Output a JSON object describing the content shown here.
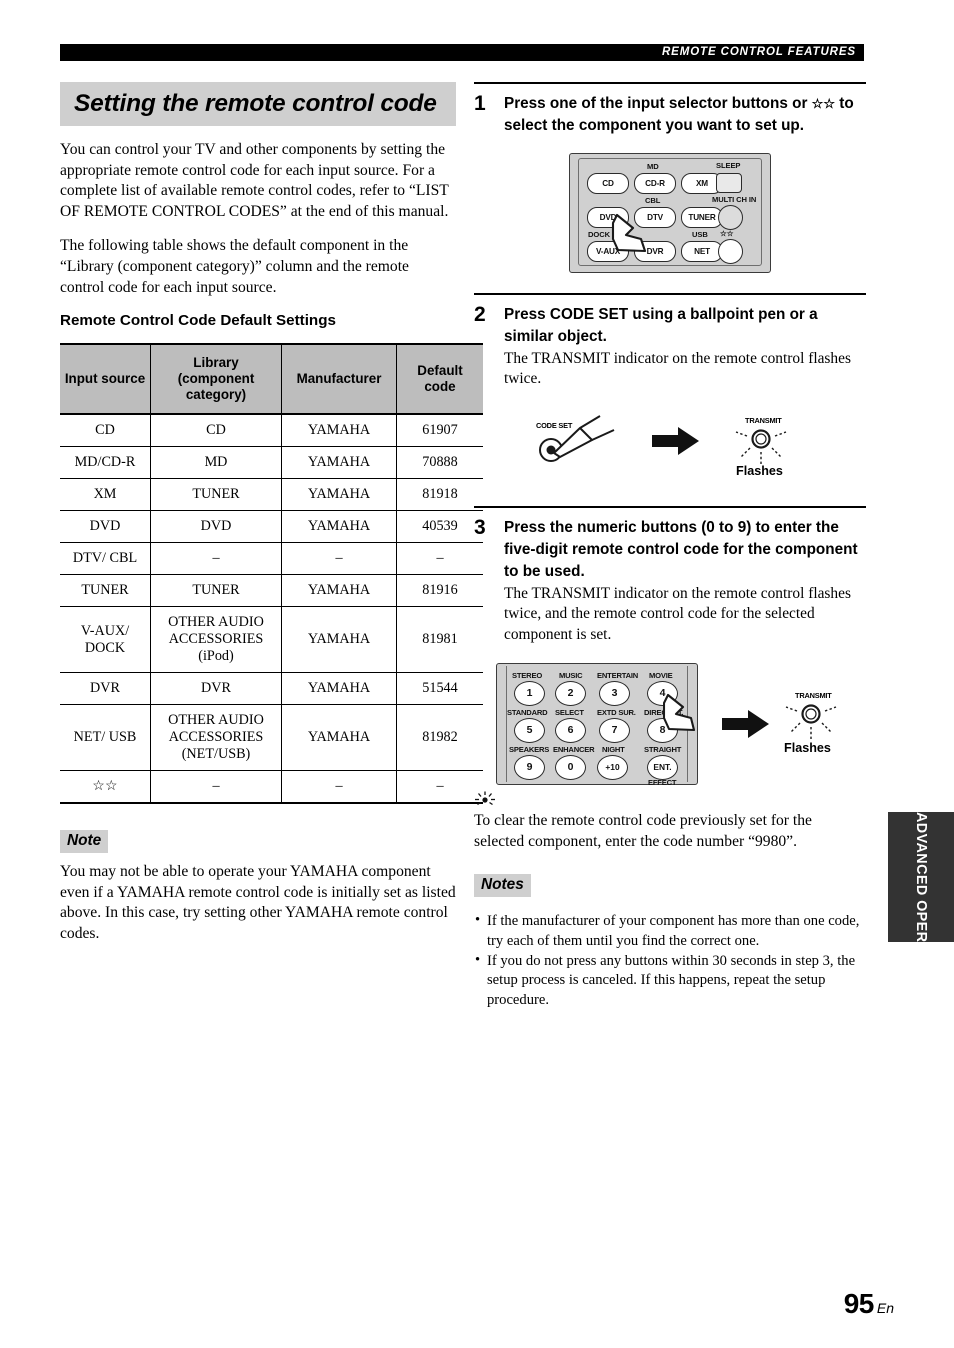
{
  "header": {
    "running_title": "REMOTE CONTROL FEATURES"
  },
  "left": {
    "section_title": "Setting the remote control code",
    "para1": "You can control your TV and other components by setting the appropriate remote control code for each input source. For a complete list of available remote control codes, refer to “LIST OF REMOTE CONTROL CODES” at the end of this manual.",
    "para2": "The following table shows the default component in the “Library (component category)” column and the remote control code for each input source.",
    "table_heading": "Remote Control Code Default Settings",
    "table": {
      "columns": [
        "Input source",
        "Library (component category)",
        "Manufacturer",
        "Default code"
      ],
      "rows": [
        [
          "CD",
          "CD",
          "YAMAHA",
          "61907"
        ],
        [
          "MD/CD-R",
          "MD",
          "YAMAHA",
          "70888"
        ],
        [
          "XM",
          "TUNER",
          "YAMAHA",
          "81918"
        ],
        [
          "DVD",
          "DVD",
          "YAMAHA",
          "40539"
        ],
        [
          "DTV/ CBL",
          "–",
          "–",
          "–"
        ],
        [
          "TUNER",
          "TUNER",
          "YAMAHA",
          "81916"
        ],
        [
          "V-AUX/ DOCK",
          "OTHER AUDIO ACCESSORIES (iPod)",
          "YAMAHA",
          "81981"
        ],
        [
          "DVR",
          "DVR",
          "YAMAHA",
          "51544"
        ],
        [
          "NET/ USB",
          "OTHER AUDIO ACCESSORIES (NET/USB)",
          "YAMAHA",
          "81982"
        ],
        [
          "☆☆",
          "–",
          "–",
          "–"
        ]
      ]
    },
    "note_label": "Note",
    "note_text": "You may not be able to operate your YAMAHA component even if a YAMAHA remote control code is initially set as listed above. In this case, try setting other YAMAHA remote control codes."
  },
  "right": {
    "steps": [
      {
        "num": "1",
        "heading_part1": "Press one of the input selector buttons or",
        "heading_stars": "☆☆",
        "heading_part2": "to select the component you want to set up.",
        "body": ""
      },
      {
        "num": "2",
        "heading": "Press CODE SET using a ballpoint pen or a similar object.",
        "body": "The TRANSMIT indicator on the remote control flashes twice."
      },
      {
        "num": "3",
        "heading": "Press the numeric buttons (0 to 9) to enter the five-digit remote control code for the component to be used.",
        "body": "The TRANSMIT indicator on the remote control flashes twice, and the remote control code for the selected component is set."
      }
    ],
    "remote_selector": {
      "buttons": [
        "CD",
        "CD-R",
        "XM",
        "DVD",
        "DTV",
        "TUNER",
        "V-AUX",
        "DVR",
        "NET"
      ],
      "labels": [
        "MD",
        "SLEEP",
        "CBL",
        "MULTI CH IN",
        "DOCK",
        "USB",
        "☆☆"
      ]
    },
    "codeset_fig": {
      "code_set_label": "CODE SET",
      "transmit_label": "TRANSMIT",
      "flashes_label": "Flashes"
    },
    "keypad": {
      "labels_row1": [
        "STEREO",
        "MUSIC",
        "ENTERTAIN",
        "MOVIE"
      ],
      "digits_row1": [
        "1",
        "2",
        "3",
        "4"
      ],
      "labels_row2": [
        "STANDARD",
        "SELECT",
        "EXTD SUR.",
        "DIRECT ST."
      ],
      "digits_row2": [
        "5",
        "6",
        "7",
        "8"
      ],
      "labels_row3": [
        "SPEAKERS",
        "ENHANCER",
        "NIGHT",
        "STRAIGHT"
      ],
      "digits_row3": [
        "9",
        "0",
        "+10",
        "ENT."
      ],
      "effect_label": "EFFECT",
      "transmit_label": "TRANSMIT",
      "flashes_label": "Flashes"
    },
    "tip_text": "To clear the remote control code previously set for the selected component, enter the code number “9980”.",
    "notes_label": "Notes",
    "notes": [
      "If the manufacturer of your component has more than one code, try each of them until you find the correct one.",
      "If you do not press any buttons within 30 seconds in step 3, the setup process is canceled. If this happens, repeat the setup procedure."
    ]
  },
  "side_tab": {
    "label": "ADVANCED OPERATION"
  },
  "footer": {
    "page_number": "95",
    "language": "En"
  }
}
